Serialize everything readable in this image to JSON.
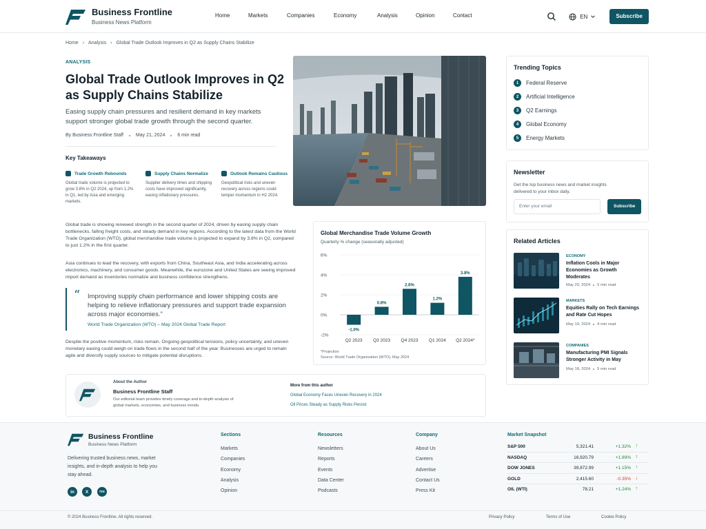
{
  "brand": {
    "name": "Business Frontline",
    "tagline": "Business News Platform"
  },
  "nav": [
    "Home",
    "Markets",
    "Companies",
    "Economy",
    "Analysis",
    "Opinion",
    "Contact"
  ],
  "header": {
    "language": "EN",
    "subscribe": "Subscribe",
    "search_icon": "search-icon",
    "globe_icon": "globe-icon"
  },
  "breadcrumb": [
    "Home",
    "Analysis",
    "Global Trade Outlook Improves in Q2 as Supply Chains Stabilize"
  ],
  "article": {
    "kicker": "ANALYSIS",
    "title": "Global Trade Outlook Improves in Q2 as Supply Chains Stabilize",
    "dek": "Easing supply chain pressures and resilient demand in key markets support stronger global trade growth through the second quarter.",
    "author": "By Business Frontline Staff",
    "date": "May 21, 2024",
    "read_time": "6 min read",
    "takeaways_title": "Key Takeaways",
    "takeaways": [
      {
        "title": "Trade Growth Rebounds",
        "body": "Global trade volume is projected to grow 3.8% in Q2 2024, up from 1.2% in Q1, led by Asia and emerging markets."
      },
      {
        "title": "Supply Chains Normalize",
        "body": "Supplier delivery times and shipping costs have improved significantly, easing inflationary pressures."
      },
      {
        "title": "Outlook Remains Cautious",
        "body": "Geopolitical risks and uneven recovery across regions could temper momentum in H2 2024."
      }
    ],
    "paragraphs": [
      "Global trade is showing renewed strength in the second quarter of 2024, driven by easing supply chain bottlenecks, falling freight costs, and steady demand in key regions. According to the latest data from the World Trade Organization (WTO), global merchandise trade volume is projected to expand by 3.8% in Q2, compared to just 1.2% in the first quarter.",
      "Asia continues to lead the recovery, with exports from China, Southeast Asia, and India accelerating across electronics, machinery, and consumer goods. Meanwhile, the eurozone and United States are seeing improved import demand as inventories normalize and business confidence strengthens.",
      "Despite the positive momentum, risks remain. Ongoing geopolitical tensions, policy uncertainty, and uneven monetary easing could weigh on trade flows in the second half of the year. Businesses are urged to remain agile and diversify supply sources to mitigate potential disruptions."
    ],
    "quote": {
      "text": "Improving supply chain performance and lower shipping costs are helping to relieve inflationary pressures and support trade expansion across major economies.”",
      "source": "World Trade Organization (WTO) – May 2024 Global Trade Report"
    }
  },
  "chart_data": {
    "type": "bar",
    "title": "Global Merchandise Trade Volume Growth",
    "subtitle": "Quarterly % change (seasonally adjusted)",
    "categories": [
      "Q2 2023",
      "Q3 2023",
      "Q4 2023",
      "Q1 2024",
      "Q2 2024*"
    ],
    "values": [
      -1.0,
      0.8,
      2.6,
      1.2,
      3.8
    ],
    "value_labels": [
      "-1.0%",
      "0.8%",
      "2.6%",
      "1.2%",
      "3.8%"
    ],
    "ylim": [
      -2,
      6
    ],
    "yticks": [
      -2,
      0,
      2,
      4,
      6
    ],
    "ytick_labels": [
      "-2%",
      "0%",
      "2%",
      "4%",
      "6%"
    ],
    "grid": true,
    "notes": [
      "*Projection",
      "Source: World Trade Organization (WTO), May 2024"
    ],
    "bar_color": "#0f5563"
  },
  "author_box": {
    "label": "About the Author",
    "name": "Business Frontline Staff",
    "bio": "Our editorial team provides timely coverage and in-depth analysis of global markets, economies, and business trends.",
    "more_label": "More from this author",
    "more": [
      "Global Economy Faces Uneven Recovery in 2024",
      "Oil Prices Steady as Supply Risks Persist"
    ]
  },
  "trending": {
    "title": "Trending Topics",
    "items": [
      "Federal Reserve",
      "Artificial Intelligence",
      "Q2 Earnings",
      "Global Economy",
      "Energy Markets"
    ]
  },
  "newsletter": {
    "title": "Newsletter",
    "text": "Get the top business news and market insights delivered to your inbox daily.",
    "placeholder": "Enter your email",
    "button": "Subscribe"
  },
  "related": {
    "title": "Related Articles",
    "items": [
      {
        "category": "ECONOMY",
        "title": "Inflation Cools in Major Economies as Growth Moderates",
        "date": "May 20, 2024",
        "read": "5 min read"
      },
      {
        "category": "MARKETS",
        "title": "Equities Rally on Tech Earnings and Rate Cut Hopes",
        "date": "May 19, 2024",
        "read": "4 min read"
      },
      {
        "category": "COMPANIES",
        "title": "Manufacturing PMI Signals Stronger Activity in May",
        "date": "May 18, 2024",
        "read": "5 min read"
      }
    ]
  },
  "footer": {
    "desc": "Delivering trusted business news, market insights, and in-depth analysis to help you stay ahead.",
    "social": [
      "in",
      "X",
      "rss"
    ],
    "columns": [
      {
        "title": "Sections",
        "items": [
          "Markets",
          "Companies",
          "Economy",
          "Analysis",
          "Opinion"
        ]
      },
      {
        "title": "Resources",
        "items": [
          "Newsletters",
          "Reports",
          "Events",
          "Data Center",
          "Podcasts"
        ]
      },
      {
        "title": "Company",
        "items": [
          "About Us",
          "Careers",
          "Advertise",
          "Contact Us",
          "Press Kit"
        ]
      }
    ],
    "market": {
      "title": "Market Snapshot",
      "rows": [
        {
          "name": "S&P 500",
          "value": "5,321.41",
          "change": "+1.32%",
          "dir": "up"
        },
        {
          "name": "NASDAQ",
          "value": "16,920.79",
          "change": "+1.89%",
          "dir": "up"
        },
        {
          "name": "DOW JONES",
          "value": "39,872.99",
          "change": "+1.15%",
          "dir": "up"
        },
        {
          "name": "GOLD",
          "value": "2,415.60",
          "change": "-0.35%",
          "dir": "down"
        },
        {
          "name": "OIL (WTI)",
          "value": "78.21",
          "change": "+1.24%",
          "dir": "up"
        }
      ]
    },
    "copyright": "© 2024 Business Frontline. All rights reserved.",
    "legal": [
      "Privacy Policy",
      "Terms of Use",
      "Cookie Policy"
    ]
  },
  "colors": {
    "brand": "#0f5563",
    "accent": "#0f6b76",
    "up": "#1f8a3a",
    "down": "#d23b2f"
  }
}
